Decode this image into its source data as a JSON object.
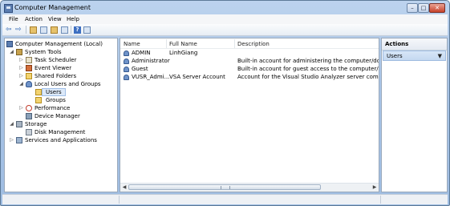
{
  "window": {
    "title": "Computer Management",
    "min_glyph": "–",
    "max_glyph": "□",
    "close_glyph": "✕"
  },
  "menu": [
    "File",
    "Action",
    "View",
    "Help"
  ],
  "toolbar": {
    "back_glyph": "⇦",
    "forward_glyph": "⇨",
    "help_glyph": "?"
  },
  "tree": {
    "root": "Computer Management (Local)",
    "system_tools": "System Tools",
    "task_scheduler": "Task Scheduler",
    "event_viewer": "Event Viewer",
    "shared_folders": "Shared Folders",
    "local_users": "Local Users and Groups",
    "users": "Users",
    "groups": "Groups",
    "performance": "Performance",
    "device_manager": "Device Manager",
    "storage": "Storage",
    "disk_management": "Disk Management",
    "services": "Services and Applications",
    "expand_glyph": "▷",
    "collapse_glyph": "◢"
  },
  "list": {
    "columns": [
      "Name",
      "Full Name",
      "Description"
    ],
    "rows": [
      {
        "name": "ADMIN",
        "full_name": "LinhGiang",
        "description": ""
      },
      {
        "name": "Administrator",
        "full_name": "",
        "description": "Built-in account for administering the computer/domain"
      },
      {
        "name": "Guest",
        "full_name": "",
        "description": "Built-in account for guest access to the computer/domain"
      },
      {
        "name": "VUSR_Admi...",
        "full_name": "VSA Server Account",
        "description": "Account for the Visual Studio Analyzer server components"
      }
    ],
    "scroll_left": "◀",
    "scroll_right": "▶"
  },
  "actions": {
    "title": "Actions",
    "section": "Users",
    "arrow": "▼"
  }
}
